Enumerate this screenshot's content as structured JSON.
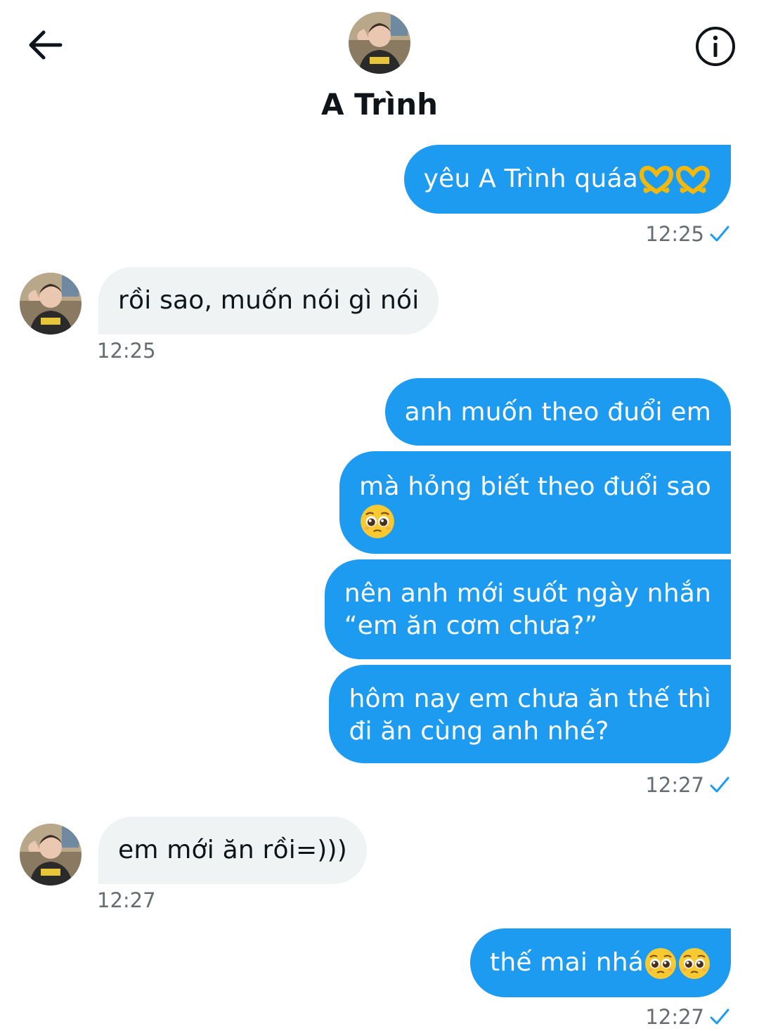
{
  "header": {
    "title": "A Trình",
    "back_icon": "arrow-left-icon",
    "info_icon": "info-circle-icon"
  },
  "colors": {
    "outgoing_bubble": "#1d9bf0",
    "incoming_bubble": "#eff3f4",
    "timestamp": "#666c70",
    "check": "#1d9bf0"
  },
  "messages": [
    {
      "from": "me",
      "text": "yêu A Trình quáa",
      "emoji": [
        "heart-hands-emoji",
        "heart-hands-emoji"
      ]
    },
    {
      "from": "me_time",
      "text": "12:25"
    },
    {
      "from": "them",
      "text": "rồi sao, muốn nói gì nói"
    },
    {
      "from": "them_time",
      "text": "12:25"
    },
    {
      "from": "me",
      "text": "anh muốn theo đuổi em"
    },
    {
      "from": "me",
      "text_l1": "mà hỏng biết theo đuổi sao",
      "emoji": [
        "pleading-face-emoji"
      ]
    },
    {
      "from": "me",
      "text_l1": "nên anh mới suốt ngày nhắn",
      "text_l2": "“em ăn cơm chưa?”"
    },
    {
      "from": "me",
      "text_l1": "hôm nay em chưa ăn thế thì",
      "text_l2": "đi ăn cùng anh nhé?"
    },
    {
      "from": "me_time",
      "text": "12:27"
    },
    {
      "from": "them",
      "text": "em mới ăn rồi=)))"
    },
    {
      "from": "them_time",
      "text": "12:27"
    },
    {
      "from": "me",
      "text": "thế mai nhá",
      "emoji": [
        "pleading-face-emoji",
        "pleading-face-emoji"
      ]
    },
    {
      "from": "me_time",
      "text": "12:27"
    }
  ]
}
